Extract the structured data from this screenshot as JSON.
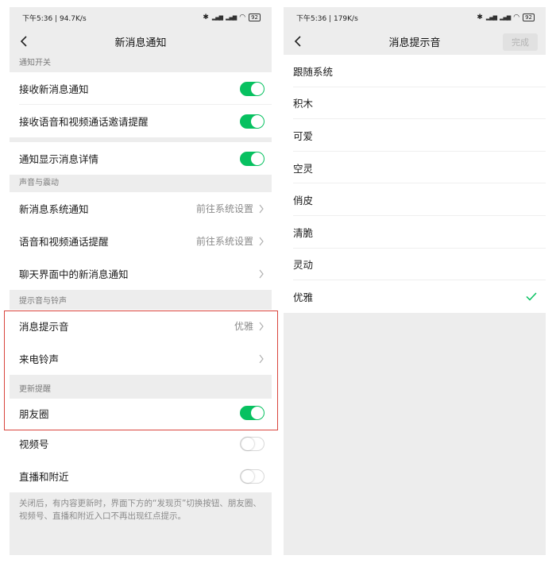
{
  "left": {
    "status": {
      "time_speed": "下午5:36 | 94.7K/s",
      "battery": "92"
    },
    "title": "新消息通知",
    "sections": [
      {
        "header": "通知开关"
      },
      {
        "header": "声音与震动"
      },
      {
        "header": "提示音与铃声"
      },
      {
        "header": "更新提醒"
      }
    ],
    "rows": {
      "receive_new": "接收新消息通知",
      "voice_video_invite": "接收语音和视频通话邀请提醒",
      "show_details": "通知显示消息详情",
      "new_msg_system": "新消息系统通知",
      "new_msg_system_value": "前往系统设置",
      "voice_video_remind": "语音和视频通话提醒",
      "voice_video_remind_value": "前往系统设置",
      "chat_new_msg": "聊天界面中的新消息通知",
      "msg_tone": "消息提示音",
      "msg_tone_value": "优雅",
      "ringtone": "来电铃声",
      "moments": "朋友圈",
      "channels": "视频号",
      "live_nearby": "直播和附近"
    },
    "toggles": {
      "receive_new": true,
      "voice_video_invite": true,
      "show_details": true,
      "moments": true,
      "channels": false,
      "live_nearby": false
    },
    "footnote": "关闭后，有内容更新时，界面下方的“发现页”切换按钮、朋友圈、视频号、直播和附近入口不再出现红点提示。"
  },
  "right": {
    "status": {
      "time_speed": "下午5:36 | 179K/s",
      "battery": "92"
    },
    "title": "消息提示音",
    "done_label": "完成",
    "tones": [
      "跟随系统",
      "积木",
      "可爱",
      "空灵",
      "俏皮",
      "清脆",
      "灵动",
      "优雅"
    ],
    "selected_index": 7
  },
  "colors": {
    "accent_green": "#07c160",
    "highlight_red": "#d9443c",
    "page_bg": "#ededed"
  },
  "icons": [
    "back-arrow-icon",
    "chevron-right-icon",
    "checkmark-icon",
    "bluetooth-icon",
    "signal-icon",
    "wifi-icon",
    "battery-icon"
  ]
}
